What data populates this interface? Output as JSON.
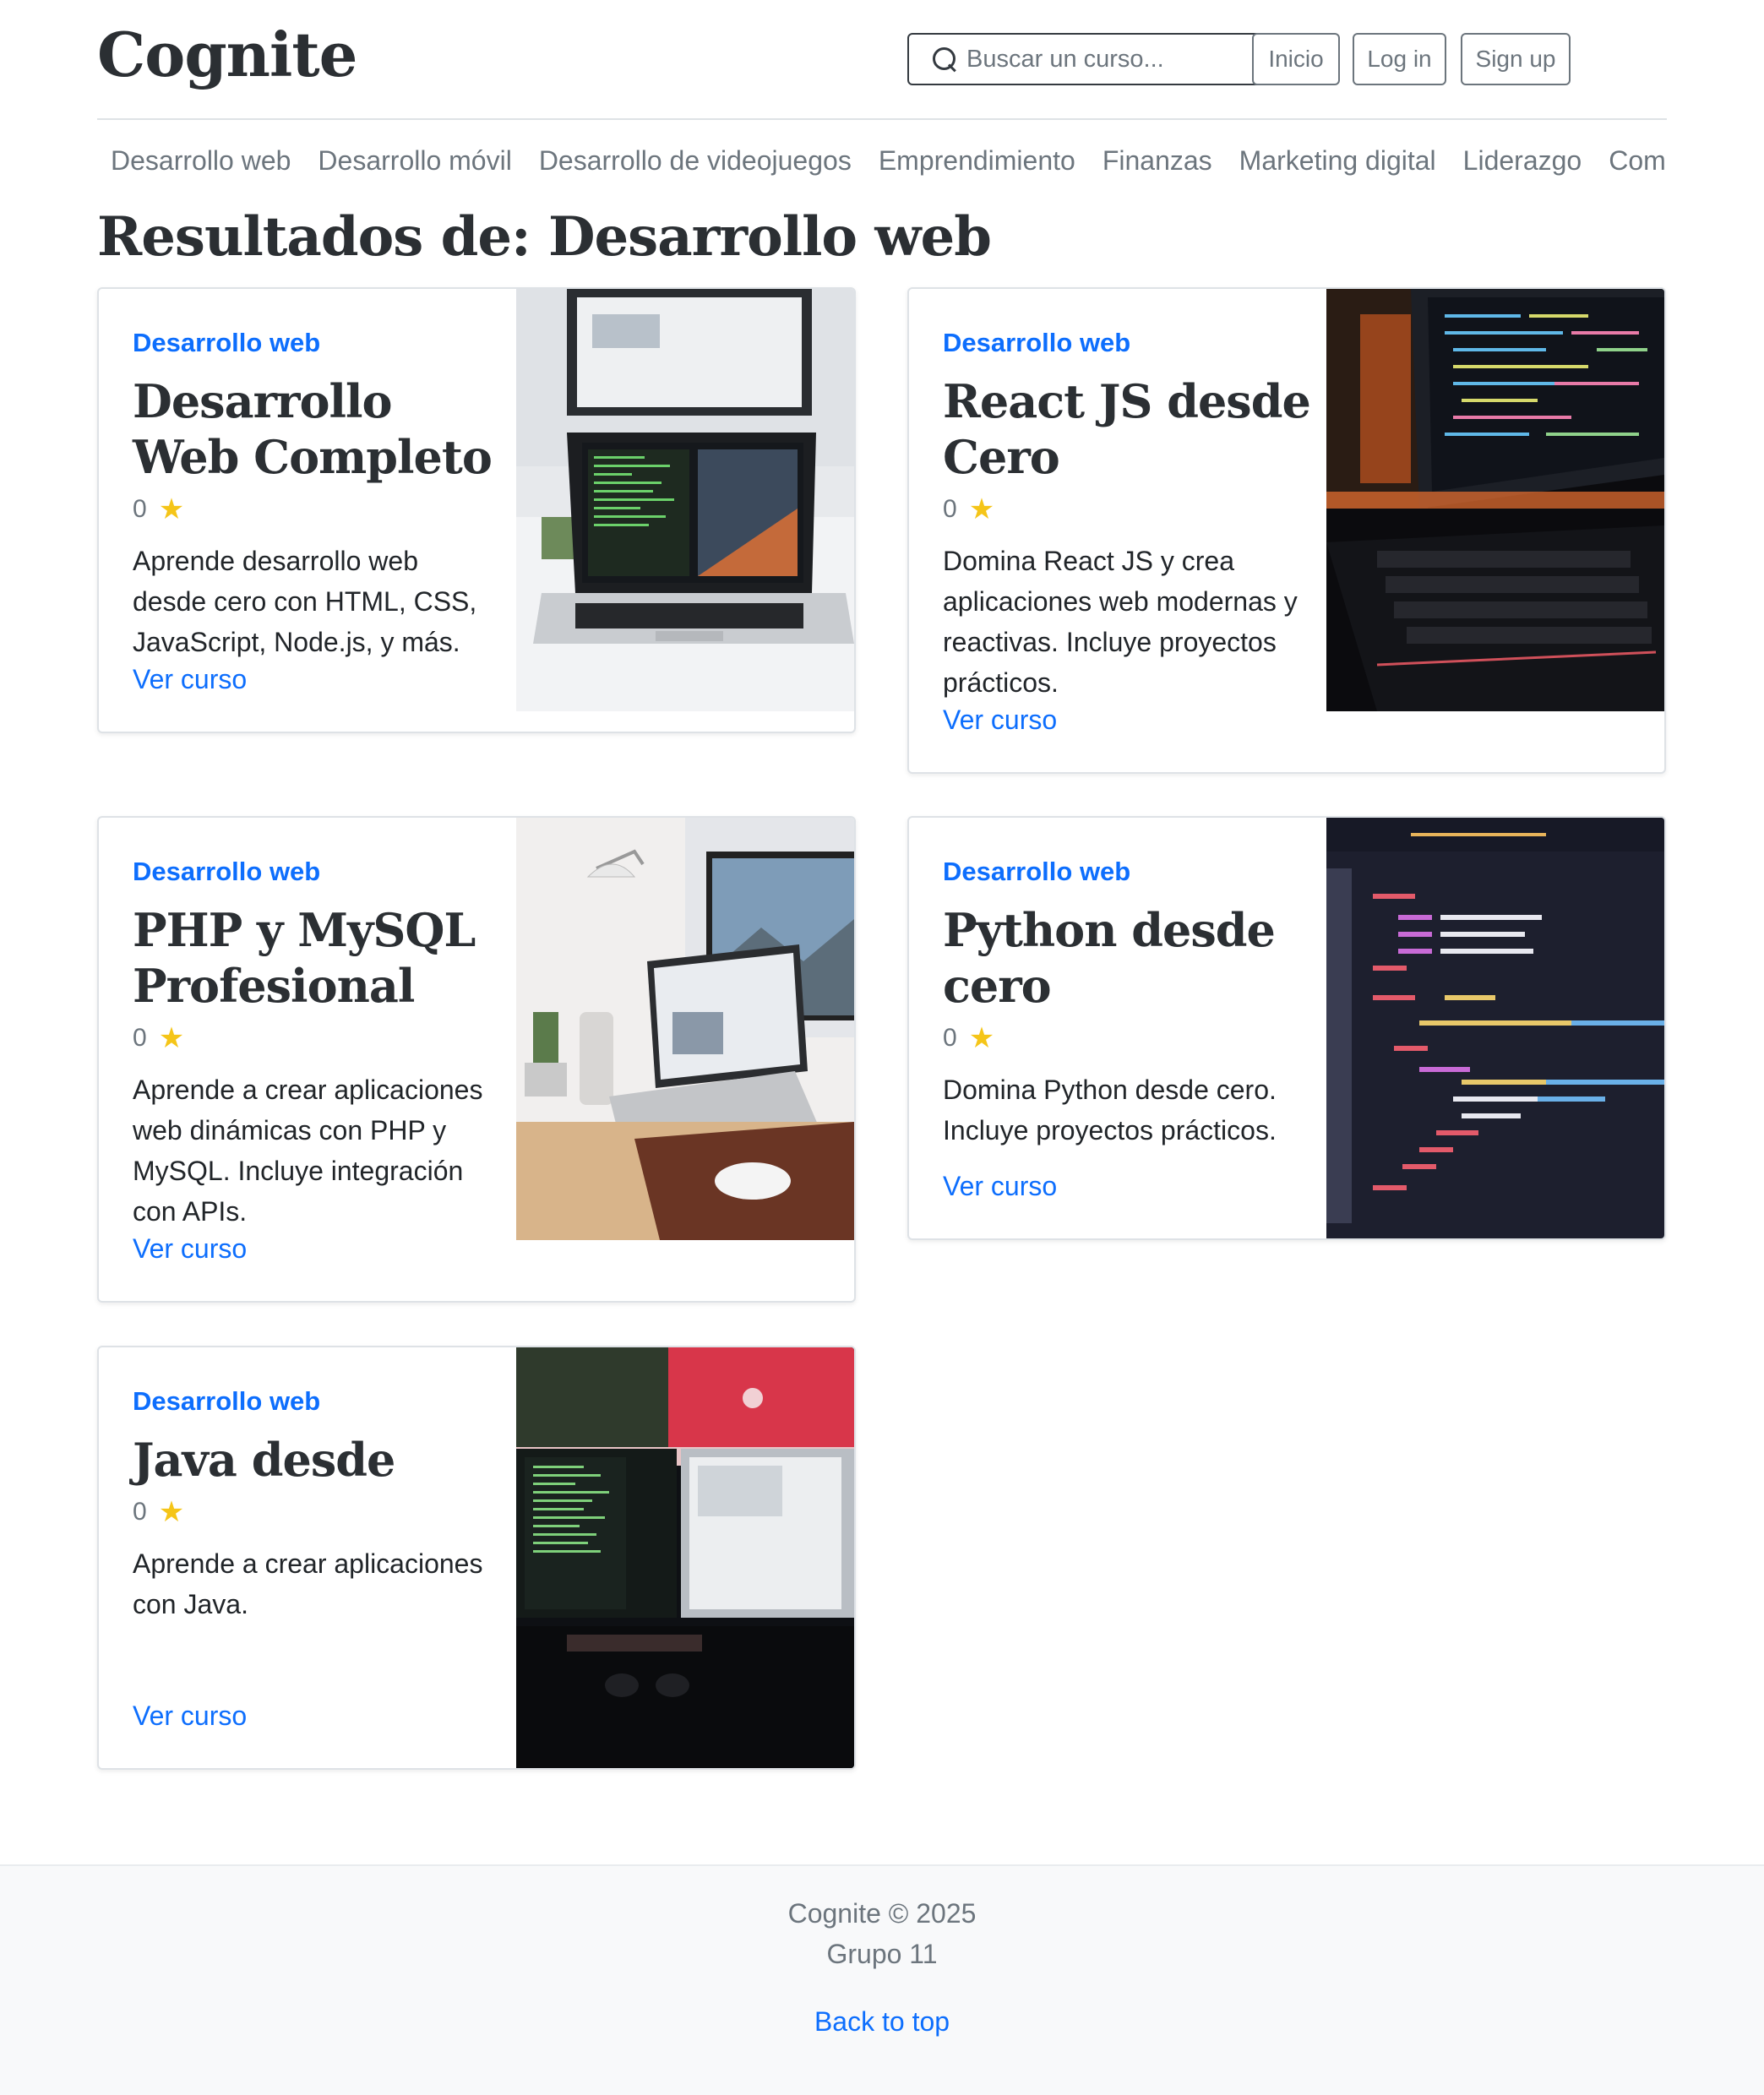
{
  "header": {
    "brand": "Cognite",
    "search_placeholder": "Buscar un curso...",
    "nav_buttons": [
      "Inicio",
      "Log in",
      "Sign up"
    ]
  },
  "categories": [
    "Desarrollo web",
    "Desarrollo móvil",
    "Desarrollo de videojuegos",
    "Emprendimiento",
    "Finanzas",
    "Marketing digital",
    "Liderazgo",
    "Comunicación"
  ],
  "results_title": "Resultados de: Desarrollo web",
  "courses": [
    {
      "category": "Desarrollo web",
      "title": "Desarrollo Web Completo",
      "rating": "0",
      "description": "Aprende desarrollo web desde cero con HTML, CSS, JavaScript, Node.js, y más.",
      "link": "Ver curso",
      "image": "laptop-desk-photo"
    },
    {
      "category": "Desarrollo web",
      "title": "React JS desde Cero",
      "rating": "0",
      "description": "Domina React JS y crea aplicaciones web modernas y reactivas. Incluye proyectos prácticos.",
      "link": "Ver curso",
      "image": "monitor-keyboard-code-photo"
    },
    {
      "category": "Desarrollo web",
      "title": "PHP y MySQL Profesional",
      "rating": "0",
      "description": "Aprende a crear aplicaciones web dinámicas con PHP y MySQL. Incluye integración con APIs.",
      "link": "Ver curso",
      "image": "workspace-laptop-lamp-photo"
    },
    {
      "category": "Desarrollo web",
      "title": "Python desde cero",
      "rating": "0",
      "description": "Domina Python desde cero. Incluye proyectos prácticos.",
      "link": "Ver curso",
      "image": "code-editor-screen-photo"
    },
    {
      "category": "Desarrollo web",
      "title": "Java desde",
      "rating": "0",
      "description": "Aprende a crear aplicaciones con Java.",
      "link": "Ver curso",
      "image": "dual-monitor-setup-photo"
    }
  ],
  "footer": {
    "copyright": "Cognite © 2025",
    "group": "Grupo 11",
    "back_to_top": "Back to top"
  },
  "colors": {
    "accent": "#0d6efd",
    "star": "#f5c518",
    "muted": "#6c757d",
    "heading": "#2b2f33"
  }
}
